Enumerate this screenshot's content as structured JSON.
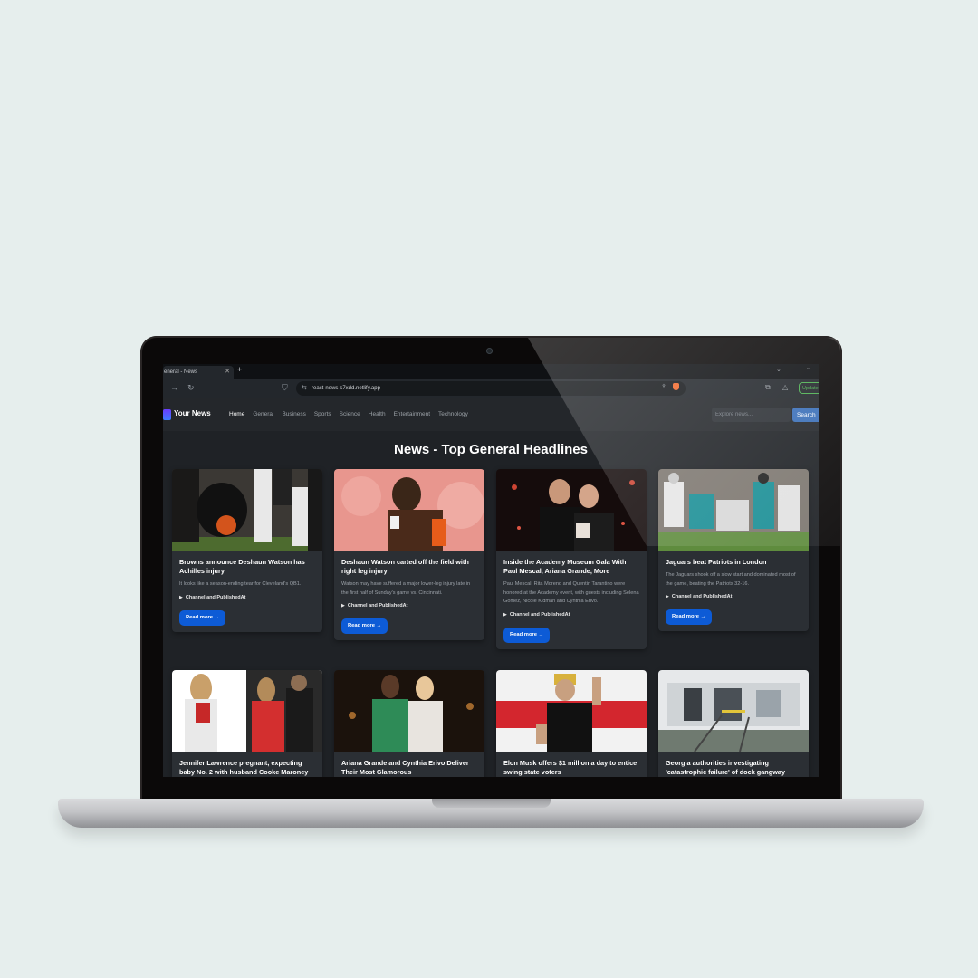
{
  "browser": {
    "tab_title": "eneral - News",
    "url": "react-news-s7xdd.netlify.app",
    "update_label": "Update"
  },
  "site": {
    "logo": "Your News",
    "nav": [
      "Home",
      "General",
      "Business",
      "Sports",
      "Science",
      "Health",
      "Entertainment",
      "Technology"
    ],
    "active_nav": "Home",
    "search_placeholder": "Explore news...",
    "search_button": "Search",
    "heading": "News - Top General Headlines"
  },
  "cards": [
    {
      "title": "Browns announce Deshaun Watson has Achilles injury",
      "description": "It looks like a season-ending tear for Cleveland's QB1.",
      "meta": "Channel and PublishedAt",
      "button": "Read more →",
      "image": "football-huddle-photo"
    },
    {
      "title": "Deshaun Watson carted off the field with right leg injury",
      "description": "Watson may have suffered a major lower-leg injury late in the first half of Sunday's game vs. Cincinnati.",
      "meta": "Channel and PublishedAt",
      "button": "Read more →",
      "image": "player-portrait-photo"
    },
    {
      "title": "Inside the Academy Museum Gala With Paul Mescal, Ariana Grande, More",
      "description": "Paul Mescal, Rita Moreno and Quentin Tarantino were honored at the Academy event, with guests including Selena Gomez, Nicole Kidman and Cynthia Erivo.",
      "meta": "Channel and PublishedAt",
      "button": "Read more →",
      "image": "gala-couple-photo"
    },
    {
      "title": "Jaguars beat Patriots in London",
      "description": "The Jaguars shook off a slow start and dominated most of the game, beating the Patriots 32-16.",
      "meta": "Channel and PublishedAt",
      "button": "Read more →",
      "image": "football-game-photo"
    },
    {
      "title": "Jennifer Lawrence pregnant, expecting baby No. 2 with husband Cooke Maroney",
      "image": "street-couple-photo"
    },
    {
      "title": "Ariana Grande and Cynthia Erivo Deliver Their Most Glamorous",
      "image": "red-carpet-photo"
    },
    {
      "title": "Elon Musk offers $1 million a day to entice swing state voters",
      "image": "rally-stage-photo"
    },
    {
      "title": "Georgia authorities investigating 'catastrophic failure' of dock gangway",
      "image": "dock-building-photo"
    }
  ]
}
